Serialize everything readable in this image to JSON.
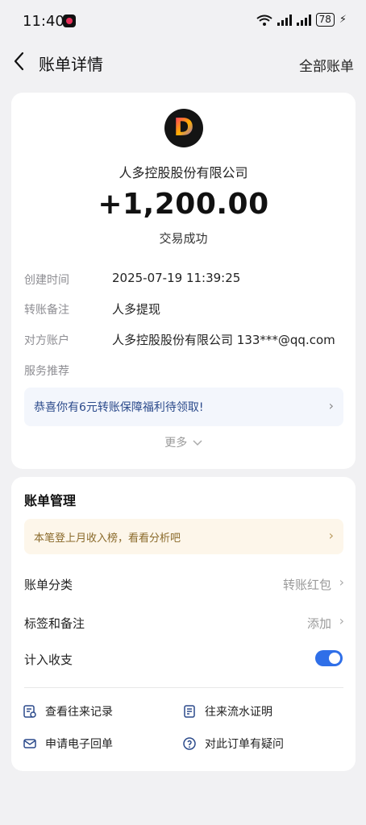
{
  "status_bar": {
    "time": "11:40",
    "battery": "78"
  },
  "header": {
    "title": "账单详情",
    "right_link": "全部账单"
  },
  "transaction": {
    "counterparty": "人多控股股份有限公司",
    "amount": "+1,200.00",
    "status": "交易成功",
    "details": [
      {
        "label": "创建时间",
        "value": "2025-07-19 11:39:25"
      },
      {
        "label": "转账备注",
        "value": "人多提现"
      },
      {
        "label": "对方账户",
        "value": "人多控股股份有限公司 133***@qq.com"
      },
      {
        "label": "服务推荐",
        "value": ""
      }
    ],
    "promo": "恭喜你有6元转账保障福利待领取!",
    "more": "更多"
  },
  "management": {
    "title": "账单管理",
    "hint": "本笔登上月收入榜，看看分析吧",
    "rows": [
      {
        "label": "账单分类",
        "value": "转账红包"
      },
      {
        "label": "标签和备注",
        "value": "添加"
      },
      {
        "label": "计入收支",
        "value": ""
      }
    ],
    "toggle_on": true,
    "actions": [
      {
        "label": "查看往来记录",
        "icon": "record-icon"
      },
      {
        "label": "往来流水证明",
        "icon": "statement-icon"
      },
      {
        "label": "申请电子回单",
        "icon": "mail-icon"
      },
      {
        "label": "对此订单有疑问",
        "icon": "question-icon"
      }
    ]
  },
  "colors": {
    "accent": "#2f6fe8",
    "promo_bg": "#f3f6fc",
    "hint_bg": "#fdf6ea"
  }
}
